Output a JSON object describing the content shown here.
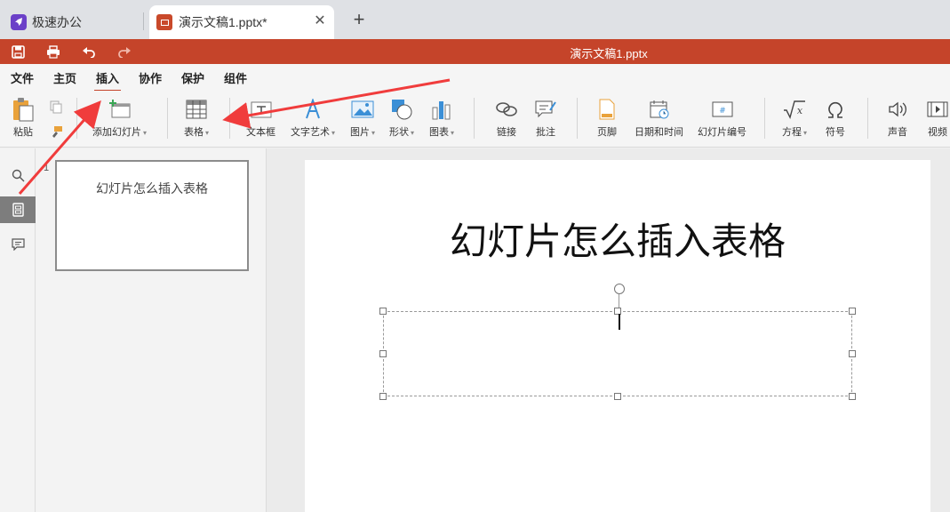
{
  "browser": {
    "tabs": [
      {
        "label": "极速办公",
        "icon": "rocket-icon"
      },
      {
        "label": "演示文稿1.pptx*",
        "icon": "presentation-icon",
        "active": true
      }
    ],
    "new_tab_glyph": "+",
    "close_glyph": "✕"
  },
  "titlebar": {
    "doc_title": "演示文稿1.pptx",
    "color": "#c5442a"
  },
  "menu": {
    "items": [
      "文件",
      "主页",
      "插入",
      "协作",
      "保护",
      "组件"
    ],
    "active": "插入"
  },
  "ribbon": {
    "paste": "粘贴",
    "add_slide": "添加幻灯片",
    "table": "表格",
    "textbox": "文本框",
    "wordart": "文字艺术",
    "image": "图片",
    "shape": "形状",
    "chart": "图表",
    "link": "链接",
    "comment": "批注",
    "footer": "页脚",
    "datetime": "日期和时间",
    "slide_number": "幻灯片编号",
    "equation": "方程",
    "symbol": "符号",
    "audio": "声音",
    "video": "视频"
  },
  "thumbnails": [
    {
      "number": "1",
      "title": "幻灯片怎么插入表格"
    }
  ],
  "slide": {
    "title": "幻灯片怎么插入表格"
  },
  "annotation_color": "#f03c3c"
}
